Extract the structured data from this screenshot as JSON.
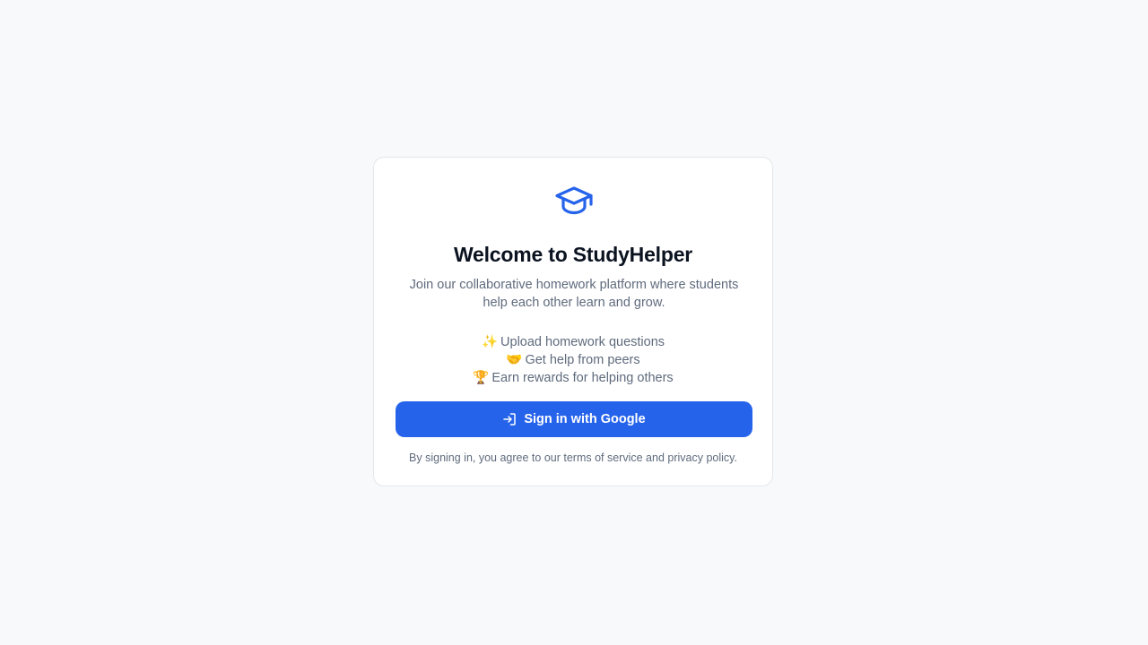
{
  "app": {
    "brand_color": "#2563eb",
    "logo_icon": "graduation-cap-icon"
  },
  "card": {
    "title": "Welcome to StudyHelper",
    "subtitle": "Join our collaborative homework platform where students help each other learn and grow.",
    "features": [
      {
        "emoji": "✨",
        "text": "Upload homework questions"
      },
      {
        "emoji": "🤝",
        "text": "Get help from peers"
      },
      {
        "emoji": "🏆",
        "text": "Earn rewards for helping others"
      }
    ],
    "signin_button": {
      "label": "Sign in with Google",
      "icon": "sign-in-icon"
    },
    "legal_text": "By signing in, you agree to our terms of service and privacy policy."
  }
}
